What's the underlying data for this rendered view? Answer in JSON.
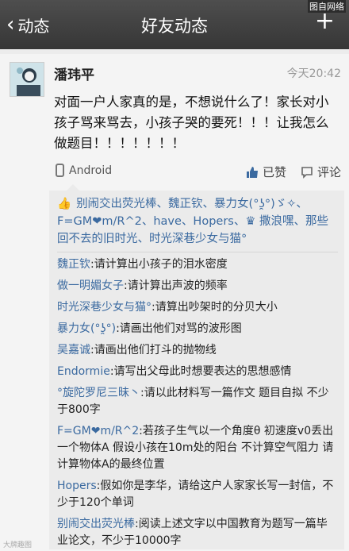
{
  "navbar": {
    "back_label": "动态",
    "title": "好友动态",
    "add_symbol": "+"
  },
  "watermark_top": "图自网络",
  "post": {
    "username": "潘玮平",
    "time": "今天20:42",
    "content": "对面一户人家真的是，不想说什么了！家长对小孩子骂来骂去，小孩子哭的要死！！！让我怎么做题目！！！！！！！",
    "platform": "Android",
    "like_label": "已赞",
    "comment_label": "评论"
  },
  "likes_text": "别闹交出荧光棒、魏正钦、暴力女(°ʖ̯°)ゞ✧、F=GM❤m/R^2、have、Hopers、♛ 撒浪嘿、那些回不去的旧时光、时光深巷少女与猫°",
  "comments": [
    {
      "name": "魏正钦",
      "text": "请计算出小孩子的泪水密度"
    },
    {
      "name": "做一明媚女子",
      "text": "请计算出声波的频率"
    },
    {
      "name": "时光深巷少女与猫°",
      "text": "请算出吵架时的分贝大小"
    },
    {
      "name": "暴力女(°ʖ̯°)",
      "text": "请画出他们对骂的波形图"
    },
    {
      "name": "吴嘉诚",
      "text": "请画出他们打斗的抛物线"
    },
    {
      "name": "Endormie",
      "text": "请写出父母此时想要表达的思想感情"
    },
    {
      "name": "°旋陀罗尼三昧丶",
      "text": "请以此材料写一篇作文 题目自拟 不少于800字"
    },
    {
      "name": "F=GM❤m/R^2",
      "text": "若孩子生气以一个角度θ 初速度v0丢出一个物体A 假设小孩在10m处的阳台 不计算空气阻力 请计算物体A的最终位置"
    },
    {
      "name": "Hopers",
      "text": "假如你是李华，请给这户人家家长写一封信，不少于120个单词"
    },
    {
      "name": "别闹交出荧光棒",
      "text": "阅读上述文字以中国教育为题写一篇毕业论文，不少于10000字"
    }
  ],
  "watermark_bottom": "大牌趣图"
}
